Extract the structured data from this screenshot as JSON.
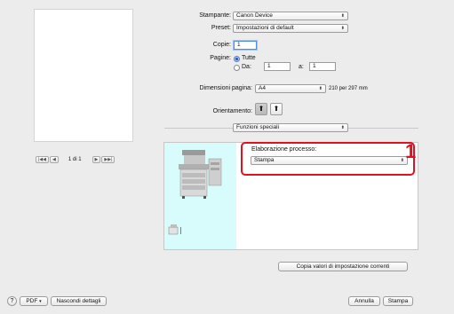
{
  "preview": {
    "nav": {
      "first": "|◀◀",
      "prev": "◀",
      "page_text": "1 di 1",
      "next": "▶",
      "last": "▶▶|"
    }
  },
  "stampante": {
    "label": "Stampante:",
    "value": "Canon Device"
  },
  "preset": {
    "label": "Preset:",
    "value": "Impostazioni di default"
  },
  "copie": {
    "label": "Copie:",
    "value": "1"
  },
  "pagine": {
    "label": "Pagine:",
    "option_all": "Tutte",
    "option_range": "Da:",
    "from": "1",
    "to_label": "a:",
    "to": "1"
  },
  "dimensioni": {
    "label": "Dimensioni pagina:",
    "value": "A4",
    "info": "210 per 297 mm"
  },
  "orientamento": {
    "label": "Orientamento:"
  },
  "panel_menu": {
    "value": "Funzioni speciali"
  },
  "elaborazione": {
    "label": "Elaborazione processo:",
    "value": "Stampa"
  },
  "callout": {
    "number": "1"
  },
  "copy_button": {
    "label": "Copia valori di impostazione correnti"
  },
  "footer": {
    "help": "?",
    "pdf": "PDF",
    "hide_details": "Nascondi dettagli",
    "cancel": "Annulla",
    "print": "Stampa"
  },
  "icons": {
    "arrows": "updown-arrows-icon",
    "portrait": "portrait-orientation-icon",
    "landscape": "landscape-orientation-icon",
    "printer": "multifunction-printer-icon",
    "finisher": "finisher-icon"
  }
}
